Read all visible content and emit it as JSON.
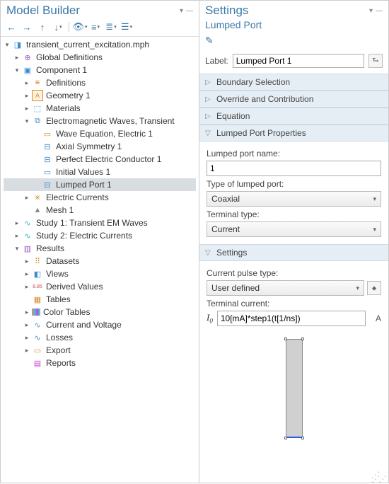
{
  "left": {
    "title": "Model Builder",
    "toolbar_icons": [
      "←",
      "→",
      "↑",
      "↓",
      "≡",
      "≣",
      "≣",
      "≣"
    ],
    "tree": [
      {
        "d": 0,
        "t": "▾",
        "ic": "ic-root",
        "g": "◨",
        "lbl": "transient_current_excitation.mph",
        "name": "root-node"
      },
      {
        "d": 1,
        "t": "▸",
        "ic": "ic-globe",
        "g": "⊕",
        "lbl": "Global Definitions",
        "name": "global-definitions-node"
      },
      {
        "d": 1,
        "t": "▾",
        "ic": "ic-comp",
        "g": "▣",
        "lbl": "Component 1",
        "name": "component-node"
      },
      {
        "d": 2,
        "t": "▸",
        "ic": "ic-def",
        "g": "≡",
        "lbl": "Definitions",
        "name": "definitions-node"
      },
      {
        "d": 2,
        "t": "▸",
        "ic": "ic-geom",
        "g": "A",
        "lbl": "Geometry 1",
        "name": "geometry-node"
      },
      {
        "d": 2,
        "t": "▸",
        "ic": "ic-mat",
        "g": "⬚",
        "lbl": "Materials",
        "name": "materials-node"
      },
      {
        "d": 2,
        "t": "▾",
        "ic": "ic-phys",
        "g": "⧉",
        "lbl": "Electromagnetic Waves, Transient",
        "name": "physics-emw-node"
      },
      {
        "d": 3,
        "t": "",
        "ic": "ic-wave",
        "g": "▭",
        "lbl": "Wave Equation, Electric 1",
        "name": "wave-equation-node"
      },
      {
        "d": 3,
        "t": "",
        "ic": "ic-axial",
        "g": "⊟",
        "lbl": "Axial Symmetry 1",
        "name": "axial-symmetry-node"
      },
      {
        "d": 3,
        "t": "",
        "ic": "ic-pec",
        "g": "⊟",
        "lbl": "Perfect Electric Conductor 1",
        "name": "pec-node"
      },
      {
        "d": 3,
        "t": "",
        "ic": "ic-init",
        "g": "▭",
        "lbl": "Initial Values 1",
        "name": "initial-values-node"
      },
      {
        "d": 3,
        "t": "",
        "ic": "ic-port",
        "g": "⊟",
        "lbl": "Lumped Port 1",
        "name": "lumped-port-node",
        "sel": true
      },
      {
        "d": 2,
        "t": "▸",
        "ic": "ic-curr",
        "g": "✳",
        "lbl": "Electric Currents",
        "name": "electric-currents-node"
      },
      {
        "d": 2,
        "t": "",
        "ic": "ic-mesh",
        "g": "▲",
        "lbl": "Mesh 1",
        "name": "mesh-node"
      },
      {
        "d": 1,
        "t": "▸",
        "ic": "ic-study",
        "g": "∿",
        "lbl": "Study 1: Transient EM Waves",
        "name": "study1-node"
      },
      {
        "d": 1,
        "t": "▸",
        "ic": "ic-study",
        "g": "∿",
        "lbl": "Study 2: Electric Currents",
        "name": "study2-node"
      },
      {
        "d": 1,
        "t": "▾",
        "ic": "ic-res",
        "g": "▥",
        "lbl": "Results",
        "name": "results-node"
      },
      {
        "d": 2,
        "t": "▸",
        "ic": "ic-data",
        "g": "⠿",
        "lbl": "Datasets",
        "name": "datasets-node"
      },
      {
        "d": 2,
        "t": "▸",
        "ic": "ic-view",
        "g": "◧",
        "lbl": "Views",
        "name": "views-node"
      },
      {
        "d": 2,
        "t": "▸",
        "ic": "ic-der",
        "g": "8.85",
        "lbl": "Derived Values",
        "name": "derived-values-node"
      },
      {
        "d": 2,
        "t": "",
        "ic": "ic-tab",
        "g": "▦",
        "lbl": "Tables",
        "name": "tables-node"
      },
      {
        "d": 2,
        "t": "▸",
        "ic": "ic-color",
        "g": "",
        "lbl": "Color Tables",
        "name": "color-tables-node"
      },
      {
        "d": 2,
        "t": "▸",
        "ic": "ic-plot",
        "g": "∿",
        "lbl": "Current and Voltage",
        "name": "current-voltage-node"
      },
      {
        "d": 2,
        "t": "▸",
        "ic": "ic-plot",
        "g": "∿",
        "lbl": "Losses",
        "name": "losses-node"
      },
      {
        "d": 2,
        "t": "▸",
        "ic": "ic-exp",
        "g": "▭",
        "lbl": "Export",
        "name": "export-node"
      },
      {
        "d": 2,
        "t": "",
        "ic": "ic-rep",
        "g": "▤",
        "lbl": "Reports",
        "name": "reports-node"
      }
    ]
  },
  "right": {
    "title": "Settings",
    "subtitle": "Lumped Port",
    "label_caption": "Label:",
    "label_value": "Lumped Port 1",
    "sections": {
      "boundary": "Boundary Selection",
      "override": "Override and Contribution",
      "equation": "Equation",
      "props": "Lumped Port Properties",
      "settings": "Settings"
    },
    "props": {
      "name_label": "Lumped port name:",
      "name_value": "1",
      "type_label": "Type of lumped port:",
      "type_value": "Coaxial",
      "term_label": "Terminal type:",
      "term_value": "Current"
    },
    "settings": {
      "pulse_label": "Current pulse type:",
      "pulse_value": "User defined",
      "term_curr_label": "Terminal current:",
      "var": "I",
      "sub": "0",
      "expr": "10[mA]*step1(t[1/ns])",
      "unit": "A"
    }
  }
}
